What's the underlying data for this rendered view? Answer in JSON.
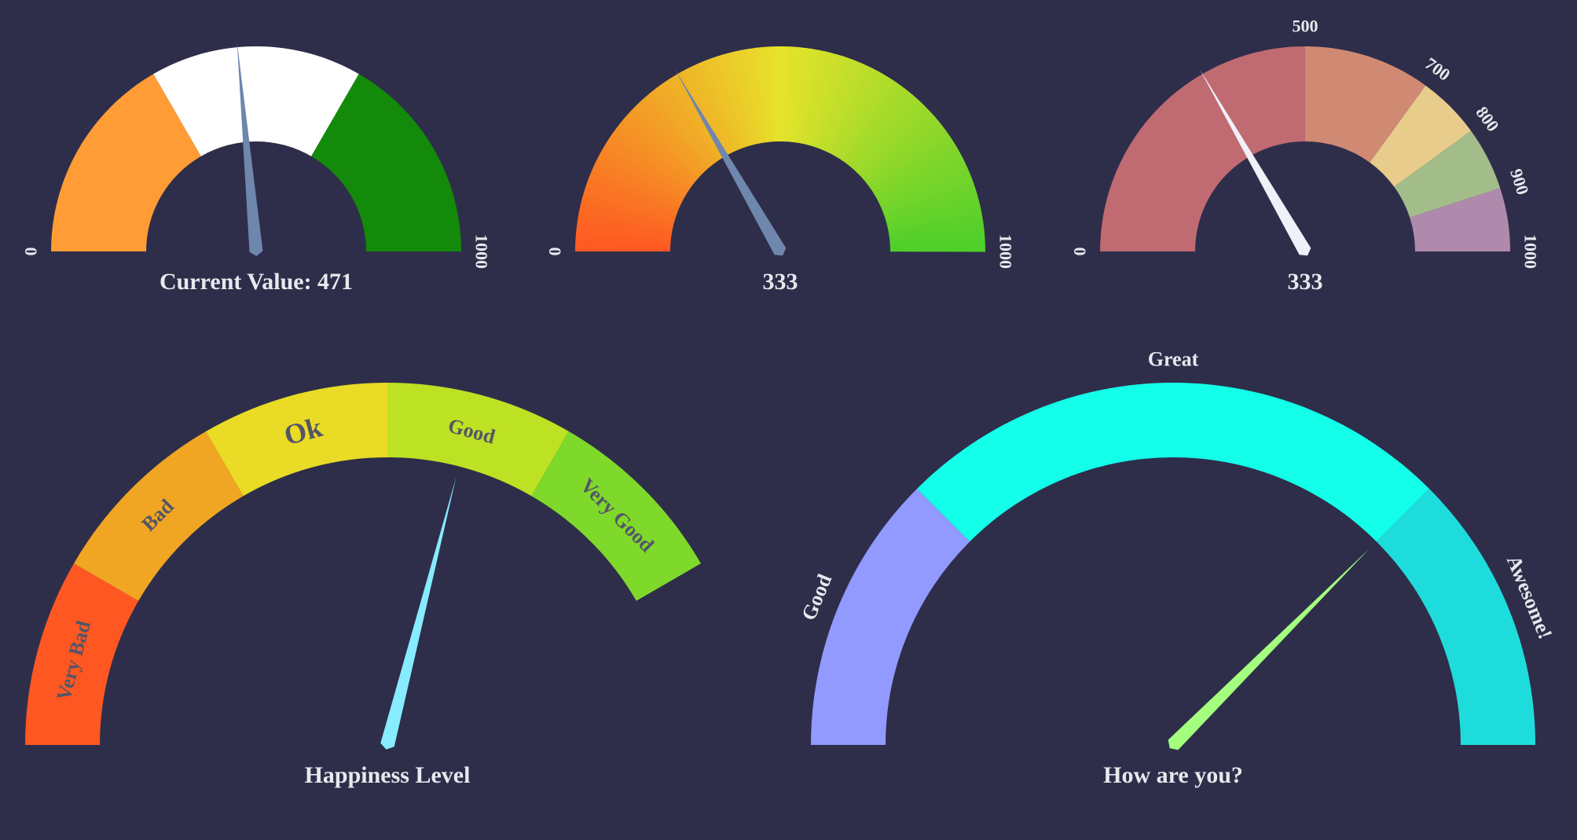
{
  "theme": {
    "background": "#2e2e4a",
    "text": "#e8e8ee",
    "segment_text": "#555566"
  },
  "chart_data": [
    {
      "type": "gauge",
      "id": "g1",
      "min": 0,
      "max": 1000,
      "value": 471,
      "current_value_label": "Current Value: 471",
      "ticks": [
        "0",
        "1000"
      ],
      "segments": [
        {
          "from": 0,
          "to": 333,
          "color": "#ff9c36"
        },
        {
          "from": 333,
          "to": 667,
          "color": "#ffffff"
        },
        {
          "from": 667,
          "to": 1000,
          "color": "#138a0a"
        }
      ],
      "needle_color": "#6f86ad"
    },
    {
      "type": "gauge",
      "id": "g2",
      "min": 0,
      "max": 1000,
      "value": 333,
      "current_value_label": "333",
      "ticks": [
        "0",
        "1000"
      ],
      "gradient": {
        "start_color": "#ff5722",
        "mid_color": "#e7e32a",
        "end_color": "#4ccf2a",
        "segments": 100
      },
      "needle_color": "#6f86ad"
    },
    {
      "type": "gauge",
      "id": "g3",
      "min": 0,
      "max": 1000,
      "value": 333,
      "current_value_label": "333",
      "ticks": [
        "0",
        "500",
        "700",
        "800",
        "900",
        "1000"
      ],
      "segments": [
        {
          "from": 0,
          "to": 500,
          "color": "#c06a72"
        },
        {
          "from": 500,
          "to": 700,
          "color": "#d08a74"
        },
        {
          "from": 700,
          "to": 800,
          "color": "#e8cc8c"
        },
        {
          "from": 800,
          "to": 900,
          "color": "#a3bd8a"
        },
        {
          "from": 900,
          "to": 1000,
          "color": "#b08aac"
        }
      ],
      "needle_color": "#f0f0f8"
    },
    {
      "type": "gauge",
      "id": "g4",
      "min": 0,
      "max": 1000,
      "value": 580,
      "current_value_label": "Happiness Level",
      "segments": [
        {
          "from": 0,
          "to": 167,
          "color": "#ff5722",
          "label": "Very Bad"
        },
        {
          "from": 167,
          "to": 333,
          "color": "#f0a622",
          "label": "Bad"
        },
        {
          "from": 333,
          "to": 500,
          "color": "#e9db26",
          "label": "Ok"
        },
        {
          "from": 500,
          "to": 667,
          "color": "#bde123",
          "label": "Good"
        },
        {
          "from": 667,
          "to": 833,
          "color": "#7ed92a",
          "label": "Very Good"
        }
      ],
      "needle_color": "#87ecff"
    },
    {
      "type": "gauge",
      "id": "g5",
      "min": 0,
      "max": 1000,
      "value": 750,
      "current_value_label": "How are you?",
      "segments": [
        {
          "from": 0,
          "to": 250,
          "color": "#9299ff",
          "label": "Good"
        },
        {
          "from": 250,
          "to": 750,
          "color": "#14ffe9",
          "label": "Great"
        },
        {
          "from": 750,
          "to": 1000,
          "color": "#1fdcdc",
          "label": "Awesome!"
        }
      ],
      "needle_color": "#a3ff7d"
    }
  ]
}
